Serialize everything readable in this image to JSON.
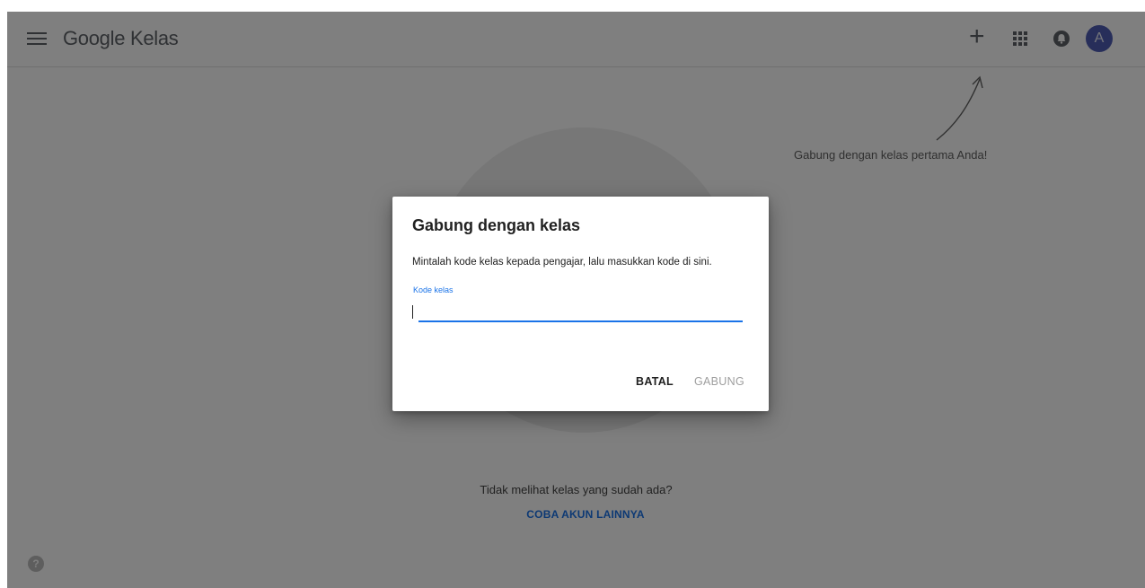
{
  "topbar": {
    "brand": "Google Kelas",
    "avatar_initial": "A",
    "icons": [
      "menu-icon",
      "plus-icon",
      "apps-grid-icon",
      "notification-icon"
    ]
  },
  "main": {
    "hint_text": "Gabung dengan kelas pertama Anda!",
    "no_classes_text": "Tidak melihat kelas yang sudah ada?",
    "try_other_link": "COBA AKUN LAINNYA",
    "help_glyph": "?"
  },
  "dialog": {
    "title": "Gabung dengan kelas",
    "description": "Mintalah kode kelas kepada pengajar, lalu masukkan kode di sini.",
    "field_label": "Kode kelas",
    "field_value": "",
    "cancel_label": "BATAL",
    "join_label": "GABUNG"
  },
  "colors": {
    "accent": "#1a73e8",
    "avatar_bg": "#4e5cb5",
    "scrim": "rgba(0,0,0,0.5)"
  }
}
